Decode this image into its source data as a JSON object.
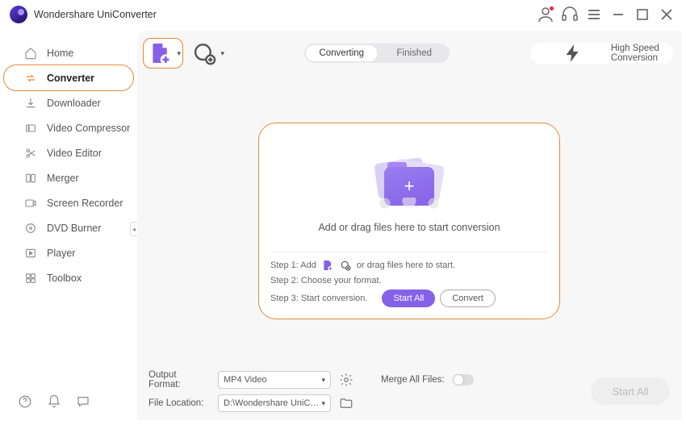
{
  "app": {
    "title": "Wondershare UniConverter"
  },
  "sidebar": {
    "items": [
      {
        "label": "Home"
      },
      {
        "label": "Converter"
      },
      {
        "label": "Downloader"
      },
      {
        "label": "Video Compressor"
      },
      {
        "label": "Video Editor"
      },
      {
        "label": "Merger"
      },
      {
        "label": "Screen Recorder"
      },
      {
        "label": "DVD Burner"
      },
      {
        "label": "Player"
      },
      {
        "label": "Toolbox"
      }
    ]
  },
  "tabs": {
    "converting": "Converting",
    "finished": "Finished"
  },
  "high_speed": "High Speed Conversion",
  "dropzone": {
    "msg": "Add or drag files here to start conversion",
    "step1a": "Step 1: Add",
    "step1b": "or drag files here to start.",
    "step2": "Step 2: Choose your format.",
    "step3": "Step 3: Start conversion.",
    "start_all": "Start All",
    "convert": "Convert"
  },
  "footer": {
    "output_format_label": "Output Format:",
    "output_format_value": "MP4 Video",
    "file_location_label": "File Location:",
    "file_location_value": "D:\\Wondershare UniConverter",
    "merge_label": "Merge All Files:",
    "start_all": "Start All"
  }
}
